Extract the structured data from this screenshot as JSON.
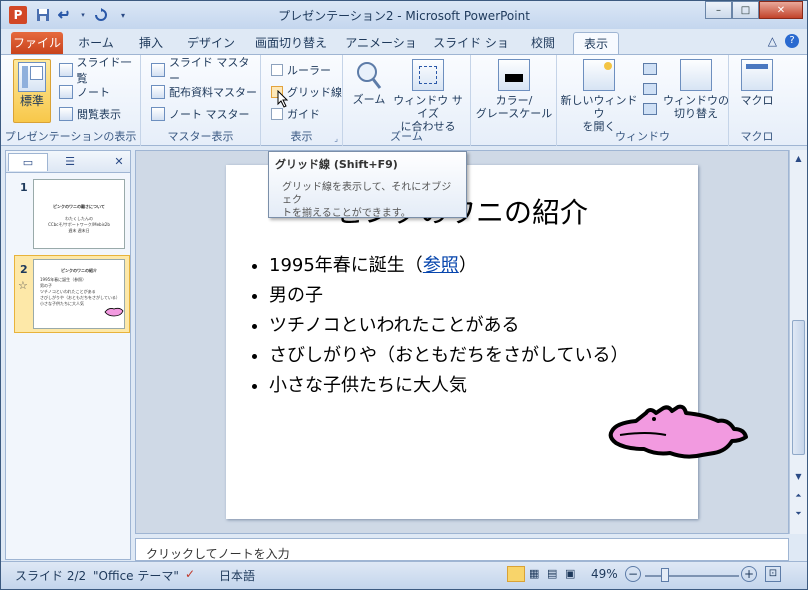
{
  "window": {
    "title": "プレゼンテーション2 - Microsoft PowerPoint",
    "app_icon_letter": "P",
    "controls": {
      "minimize": "–",
      "maximize": "□",
      "close": "✕"
    }
  },
  "tabs": [
    "ファイル",
    "ホーム",
    "挿入",
    "デザイン",
    "画面切り替え",
    "アニメーション",
    "スライド ショー",
    "校閲",
    "表示"
  ],
  "active_tab": "表示",
  "ribbon": {
    "presentation_views": {
      "label": "プレゼンテーションの表示",
      "normal": "標準",
      "slide_sorter": "スライド一覧",
      "notes": "ノート",
      "reading": "閲覧表示"
    },
    "master_views": {
      "label": "マスター表示",
      "slide_master": "スライド マスター",
      "handout_master": "配布資料マスター",
      "notes_master": "ノート マスター"
    },
    "show": {
      "label": "表示",
      "ruler": "ルーラー",
      "gridlines": "グリッド線",
      "guides": "ガイド"
    },
    "zoom": {
      "label": "ズーム",
      "zoom": "ズーム",
      "fit_line1": "ウィンドウ サイズ",
      "fit_line2": "に合わせる"
    },
    "color": {
      "line1": "カラー/",
      "line2": "グレースケール"
    },
    "window": {
      "label": "ウィンドウ",
      "new_window_line1": "新しいウィンドウ",
      "new_window_line2": "を開く",
      "switch_line1": "ウィンドウの",
      "switch_line2": "切り替え"
    },
    "macro": {
      "label": "マクロ",
      "macro": "マクロ"
    }
  },
  "tooltip": {
    "title": "グリッド線 (Shift+F9)",
    "body_line1": "グリッド線を表示して、それにオブジェク",
    "body_line2": "トを揃えることができます。"
  },
  "thumbnails": [
    {
      "number": "1",
      "title": "ピンクのワニの離さについて",
      "lines": [
        "わたくしたんの",
        "CCbcそ/サポートワーク/Mebis2b",
        "週末 週末日"
      ]
    },
    {
      "number": "2",
      "title": "ピンクのワニの紹介",
      "lines": [
        "1995年春に誕生（参照）",
        "男の子",
        "ツチノコといわれたことがある",
        "さびしがりや（おともだちをさがしている）",
        "小さな子供たちに大人気"
      ]
    }
  ],
  "slide": {
    "title": "ピンクのワニの紹介",
    "bullets": [
      {
        "text": "1995年春に誕生（",
        "link": "参照",
        "after": "）"
      },
      {
        "text": "男の子"
      },
      {
        "text": "ツチノコといわれたことがある"
      },
      {
        "text": "さびしがりや（おともだちをさがしている）"
      },
      {
        "text": "小さな子供たちに大人気"
      }
    ],
    "image_color": "#f29ae0"
  },
  "notes_placeholder": "クリックしてノートを入力",
  "status": {
    "slide": "スライド 2/2",
    "theme": "\"Office テーマ\"",
    "language": "日本語",
    "zoom": "49%"
  },
  "colors": {
    "file_tab": "#d24726",
    "selected_button": "#f8c84a",
    "frame": "#dfe9f5"
  }
}
